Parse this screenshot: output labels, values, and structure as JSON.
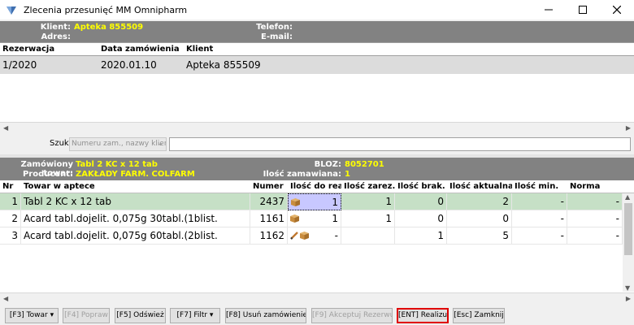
{
  "window": {
    "title": "Zlecenia przesunięć MM Omnipharm",
    "minimize": "—",
    "maximize": "☐",
    "close": "✕"
  },
  "client": {
    "klient_label": "Klient:",
    "klient_value": "Apteka 855509",
    "adres_label": "Adres:",
    "adres_value": "",
    "telefon_label": "Telefon:",
    "telefon_value": "",
    "email_label": "E-mail:",
    "email_value": ""
  },
  "reservations": {
    "columns": [
      "Rezerwacja",
      "Data zamówienia",
      "Klient"
    ],
    "rows": [
      [
        "1/2020",
        "2020.01.10",
        "Apteka 855509"
      ]
    ]
  },
  "search": {
    "label": "Szukaj",
    "placeholder": "Numeru zam., nazwy klienta",
    "value": ""
  },
  "product": {
    "towar_label": "Zamówiony towar:",
    "towar_value": "Tabl 2 KC x  12 tab",
    "producent_label": "Producent:",
    "producent_value": "ZAKŁADY FARM. COLFARM",
    "bloz_label": "BLOZ:",
    "bloz_value": "8052701",
    "ilosc_label": "Ilość zamawiana:",
    "ilosc_value": "1"
  },
  "items": {
    "columns": [
      "Nr",
      "Towar w aptece",
      "Numer",
      "Ilość do real.",
      "Ilość zarez.",
      "Ilość brak.",
      "Ilość aktualna",
      "Ilość min.",
      "Norma"
    ],
    "rows": [
      {
        "nr": "1",
        "towar": "Tabl 2 KC x  12 tab",
        "numer": "2437",
        "icons": [
          "box-icon"
        ],
        "do_real": "1",
        "zarez": "1",
        "brak": "0",
        "aktualna": "2",
        "min": "-",
        "norma": "-"
      },
      {
        "nr": "2",
        "towar": "Acard tabl.dojelit. 0,075g 30tabl.(1blist.",
        "numer": "1161",
        "icons": [
          "box-icon"
        ],
        "do_real": "1",
        "zarez": "1",
        "brak": "0",
        "aktualna": "0",
        "min": "-",
        "norma": "-"
      },
      {
        "nr": "3",
        "towar": "Acard tabl.dojelit. 0,075g 60tabl.(2blist.",
        "numer": "1162",
        "icons": [
          "pencil-icon",
          "box-icon"
        ],
        "do_real": "-",
        "zarez": "",
        "brak": "1",
        "aktualna": "5",
        "min": "-",
        "norma": "-"
      }
    ]
  },
  "footer": {
    "towar": "[F3] Towar ▾",
    "popraw": "[F4] Popraw",
    "odswiez": "[F5] Odśwież",
    "filtr": "[F7] Filtr ▾",
    "usun": "[F8] Usuń zamówienie",
    "akceptuj": "[F9] Akceptuj Rezerwuj",
    "realizuj": "[ENT] Realizuj",
    "zamknij": "[Esc] Zamknij"
  },
  "colors": {
    "header_bg": "#828282",
    "header_label": "#ffffff",
    "header_value": "#ffff00",
    "selected_row": "#c6e0c6",
    "focus_cell": "#c8c8ff",
    "active_button_border": "#e00000"
  }
}
